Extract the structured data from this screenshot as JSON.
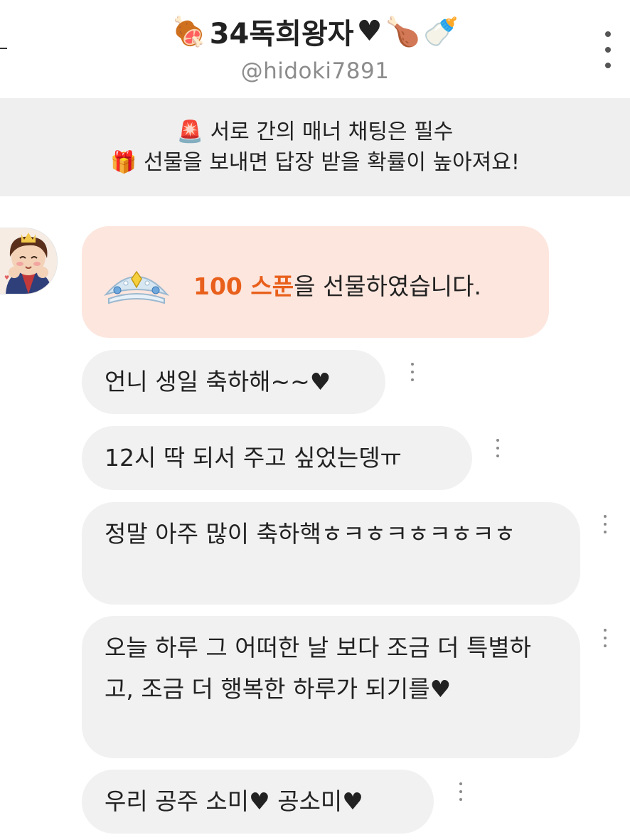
{
  "header": {
    "title": "34독희왕자",
    "leading_emoji": "🍖",
    "trailing_emoji_1": "🍗",
    "trailing_emoji_2": "🍼",
    "heart": "♥",
    "handle": "@hidoki7891"
  },
  "notice": {
    "line1_icon": "🚨",
    "line1": "서로 간의 매너 채팅은 필수",
    "line2_icon": "🎁",
    "line2": "선물을 보내면 답장 받을 확률이 높아져요!"
  },
  "gift": {
    "amount": "100 스푼",
    "text": "을 선물하였습니다."
  },
  "messages": [
    {
      "text": "언니 생일 축하해~~♥"
    },
    {
      "text": "12시 딱 되서 주고 싶었는뎅ㅠ"
    },
    {
      "text": "정말 아주 많이 축하핵ㅎㅋㅎㅋㅎㅋㅎㅋㅎ"
    },
    {
      "text": "오늘 하루 그 어떠한 날 보다 조금 더 특별하고, 조금 더 행복한 하루가 되기를♥"
    },
    {
      "text": "우리 공주 소미♥ 공소미♥"
    }
  ],
  "icons": {
    "header_more": "more-vertical-icon",
    "message_more": "more-vertical-icon",
    "gift": "tiara-icon",
    "siren": "siren-icon",
    "present": "gift-box-icon"
  },
  "colors": {
    "gift_bubble_bg": "#fde6de",
    "gift_amount": "#e8601c",
    "bubble_bg": "#f1f1f1",
    "notice_bg": "#efefef",
    "handle": "#8c8c8c"
  }
}
